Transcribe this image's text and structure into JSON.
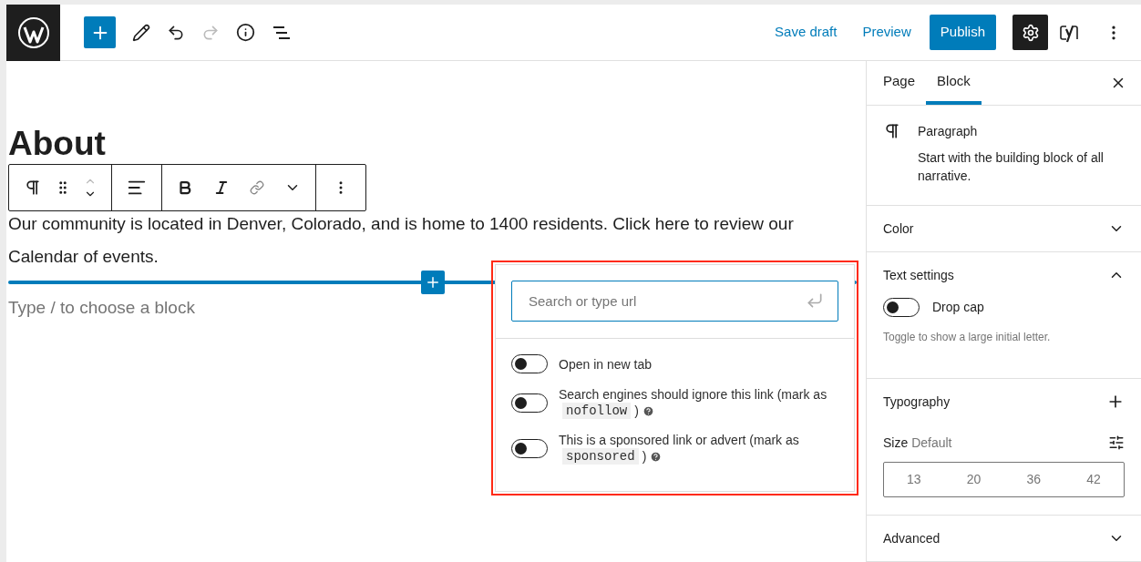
{
  "top_bar": {
    "buttons": [
      {
        "label": "Save draft",
        "kind": "link"
      },
      {
        "label": "Preview",
        "kind": "link"
      },
      {
        "label": "Publish",
        "kind": "primary"
      }
    ],
    "redo": {
      "disabled": true
    },
    "settings": {
      "selected": true
    }
  },
  "editor": {
    "heading": "About",
    "paragraph": "Our community is located in Denver, Colorado, and is home to 1400 residents. Click here to review our Calendar of events.",
    "placeholder": "Type / to choose a block"
  },
  "link_popover": {
    "search": {
      "placeholder": "Search or type url"
    },
    "options": [
      {
        "label": "Open in new tab",
        "on": false
      },
      {
        "label": "Search engines should ignore this link (mark as",
        "code": "nofollow",
        "after": ")",
        "on": false
      },
      {
        "label": "This is a sponsored link or advert (mark as",
        "code": "sponsored",
        "after": ")",
        "on": false
      }
    ]
  },
  "sidebar": {
    "tabs": [
      {
        "label": "Page",
        "selected": false
      },
      {
        "label": "Block",
        "selected": true
      }
    ],
    "block": {
      "title": "Paragraph",
      "description": "Start with the building block of all narrative."
    },
    "panels": [
      {
        "title": "Color",
        "kind": "collapsible",
        "expanded": false
      },
      {
        "title": "Text settings",
        "kind": "collapsible",
        "expanded": true,
        "toggle": {
          "label": "Drop cap",
          "on": false
        },
        "help": "Toggle to show a large initial letter."
      },
      {
        "title": "Typography",
        "kind": "tools",
        "size_label": "Size",
        "size_value": "Default",
        "sizes": [
          {
            "label": "13",
            "selected": false
          },
          {
            "label": "20",
            "selected": false
          },
          {
            "label": "36",
            "selected": false
          },
          {
            "label": "42",
            "selected": false
          }
        ]
      },
      {
        "title": "Advanced",
        "kind": "collapsible",
        "expanded": false
      }
    ]
  }
}
